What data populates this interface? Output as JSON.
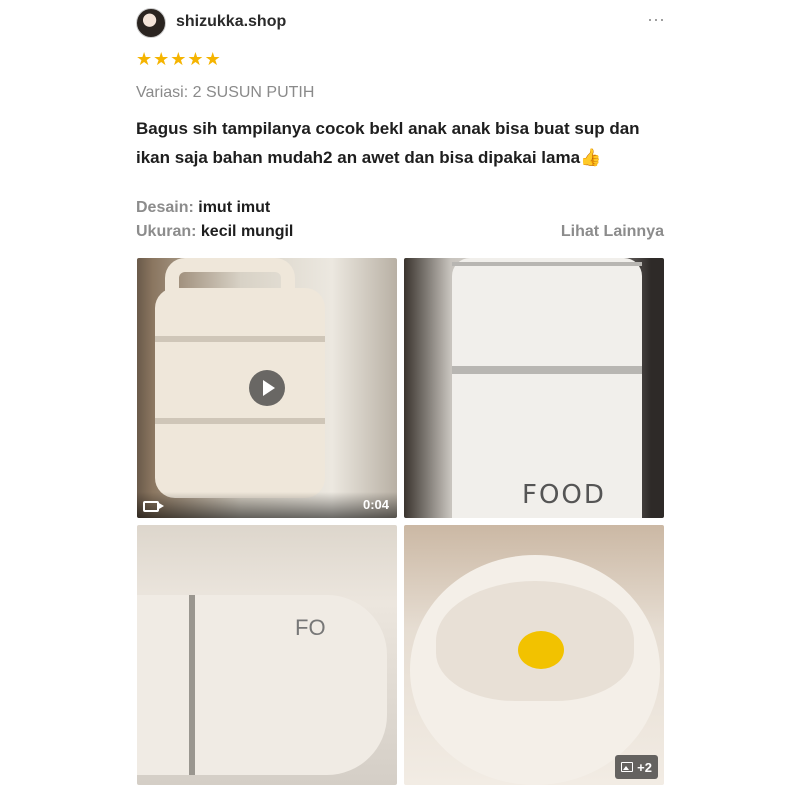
{
  "header": {
    "shop_name": "shizukka.shop",
    "more_icon": "⋯"
  },
  "rating": {
    "stars": 5,
    "star_glyph": "★",
    "star_color": "#f5b400"
  },
  "variant": {
    "label": "Variasi:",
    "value": "2 SUSUN PUTIH"
  },
  "review": {
    "text": "Bagus sih tampilanya cocok bekl anak anak bisa buat sup dan ikan saja bahan mudah2 an awet dan bisa dipakai lama",
    "emoji": "👍"
  },
  "attributes": [
    {
      "label": "Desain:",
      "value": "imut imut"
    },
    {
      "label": "Ukuran:",
      "value": "kecil mungil"
    }
  ],
  "see_more_label": "Lihat Lainnya",
  "media": {
    "video_duration": "0:04",
    "more_count": "+2",
    "product_logo": "FOOD",
    "product_logo_short": "FO"
  }
}
